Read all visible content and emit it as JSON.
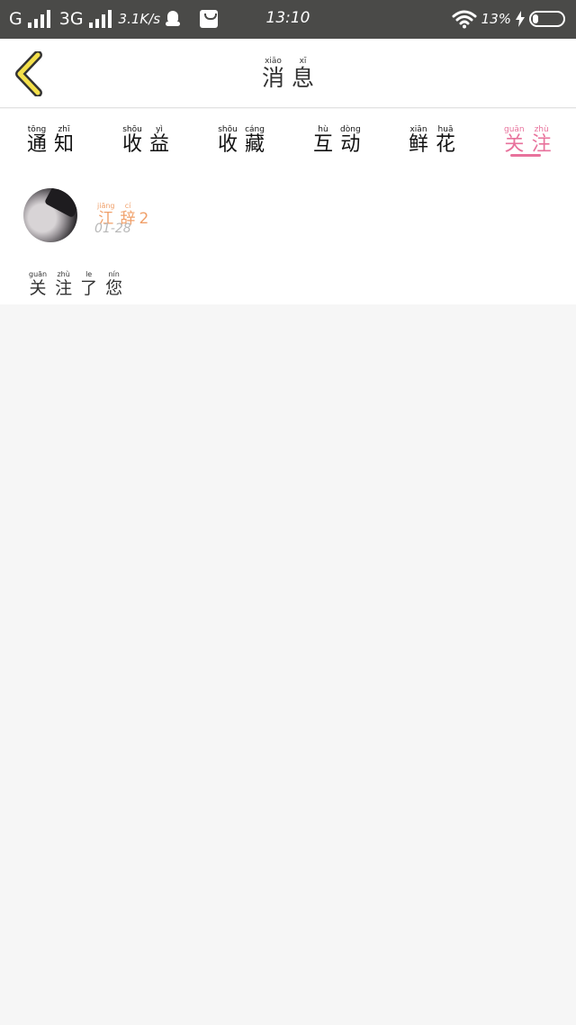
{
  "status_bar": {
    "carrier1": "G",
    "carrier2": "3G",
    "speed": "3.1K/s",
    "time": "13:10",
    "battery": "13%"
  },
  "header": {
    "title": [
      {
        "py": "xiāo",
        "hz": "消"
      },
      {
        "py": "xī",
        "hz": "息"
      }
    ]
  },
  "tabs": [
    {
      "chars": [
        {
          "py": "tōng",
          "hz": "通"
        },
        {
          "py": "zhī",
          "hz": "知"
        }
      ]
    },
    {
      "chars": [
        {
          "py": "shōu",
          "hz": "收"
        },
        {
          "py": "yì",
          "hz": "益"
        }
      ]
    },
    {
      "chars": [
        {
          "py": "shōu",
          "hz": "收"
        },
        {
          "py": "cáng",
          "hz": "藏"
        }
      ]
    },
    {
      "chars": [
        {
          "py": "hù",
          "hz": "互"
        },
        {
          "py": "dòng",
          "hz": "动"
        }
      ]
    },
    {
      "chars": [
        {
          "py": "xiān",
          "hz": "鲜"
        },
        {
          "py": "huā",
          "hz": "花"
        }
      ]
    },
    {
      "chars": [
        {
          "py": "guān",
          "hz": "关"
        },
        {
          "py": "zhù",
          "hz": "注"
        }
      ]
    }
  ],
  "active_tab": "关注",
  "accent_color": "#e8729c",
  "message": {
    "username": [
      {
        "py": "jiāng",
        "hz": "江"
      },
      {
        "py": "cí",
        "hz": "辞"
      }
    ],
    "username_suffix": "2",
    "date": "01-28",
    "text": [
      {
        "py": "guān",
        "hz": "关"
      },
      {
        "py": "zhù",
        "hz": "注"
      },
      {
        "py": "le",
        "hz": "了"
      },
      {
        "py": "nín",
        "hz": "您"
      }
    ]
  }
}
